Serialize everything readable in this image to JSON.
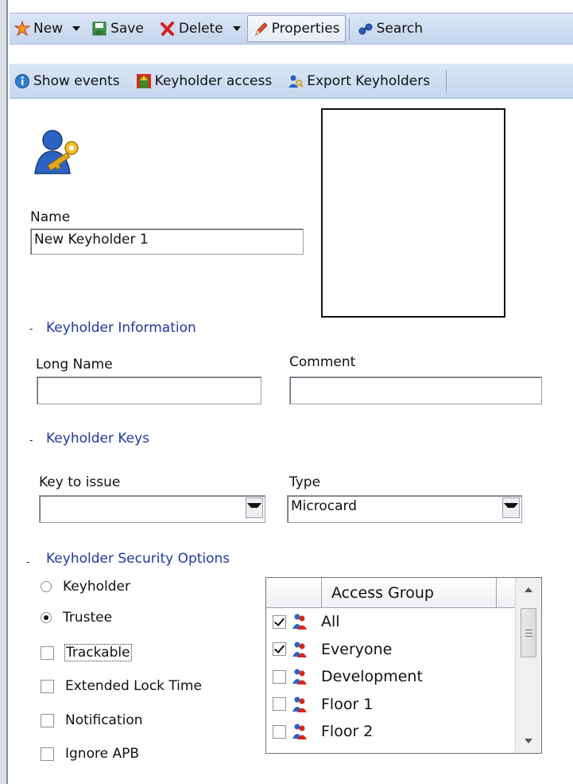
{
  "toolbar1": {
    "new_label": "New",
    "save_label": "Save",
    "delete_label": "Delete",
    "properties_label": "Properties",
    "search_label": "Search"
  },
  "toolbar2": {
    "show_events_label": "Show events",
    "keyholder_access_label": "Keyholder access",
    "export_keyholders_label": "Export Keyholders"
  },
  "form": {
    "name_label": "Name",
    "name_value": "New Keyholder 1",
    "sections": {
      "info": "Keyholder Information",
      "keys": "Keyholder Keys",
      "security": "Keyholder Security Options"
    },
    "long_name_label": "Long Name",
    "long_name_value": "",
    "comment_label": "Comment",
    "comment_value": "",
    "key_to_issue_label": "Key to issue",
    "key_to_issue_value": "",
    "type_label": "Type",
    "type_value": "Microcard",
    "collapse_symbol": "-"
  },
  "security": {
    "keyholder_label": "Keyholder",
    "keyholder_selected": false,
    "trustee_label": "Trustee",
    "trustee_selected": true,
    "options": [
      {
        "label": "Trackable",
        "checked": false
      },
      {
        "label": "Extended Lock Time",
        "checked": false
      },
      {
        "label": "Notification",
        "checked": false
      },
      {
        "label": "Ignore APB",
        "checked": false
      }
    ]
  },
  "access_groups": {
    "column_header": "Access Group",
    "rows": [
      {
        "name": "All",
        "checked": true
      },
      {
        "name": "Everyone",
        "checked": true
      },
      {
        "name": "Development",
        "checked": false
      },
      {
        "name": "Floor 1",
        "checked": false
      },
      {
        "name": "Floor 2",
        "checked": false
      }
    ]
  }
}
